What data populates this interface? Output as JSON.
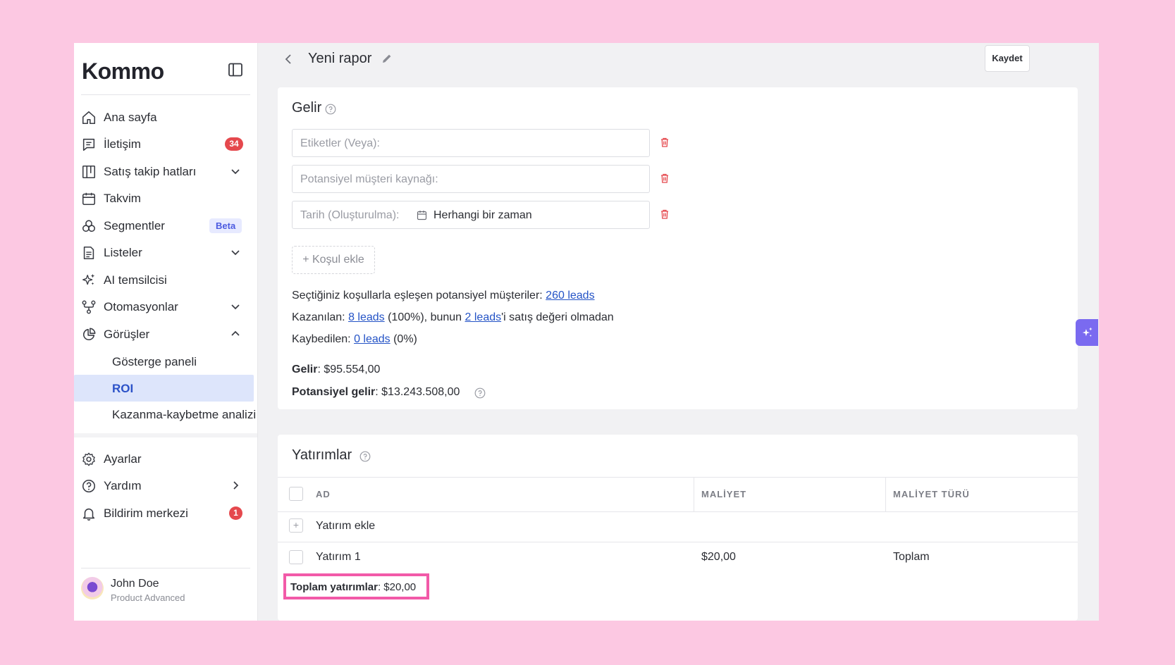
{
  "brand": {
    "logo_text": "Kommo"
  },
  "sidebar": {
    "items": [
      {
        "label": "Ana sayfa"
      },
      {
        "label": "İletişim",
        "badge": "34"
      },
      {
        "label": "Satış takip hatları"
      },
      {
        "label": "Takvim"
      },
      {
        "label": "Segmentler",
        "badge": "Beta"
      },
      {
        "label": "Listeler"
      },
      {
        "label": "AI temsilcisi"
      },
      {
        "label": "Otomasyonlar"
      },
      {
        "label": "Görüşler"
      }
    ],
    "sub_items": [
      {
        "label": "Gösterge paneli"
      },
      {
        "label": "ROI",
        "active": true
      },
      {
        "label": "Kazanma-kaybetme analizi"
      }
    ],
    "bottom_items": [
      {
        "label": "Ayarlar"
      },
      {
        "label": "Yardım"
      },
      {
        "label": "Bildirim merkezi",
        "badge": "1"
      }
    ],
    "user": {
      "name": "John Doe",
      "role": "Product Advanced"
    }
  },
  "header": {
    "title": "Yeni rapor",
    "save_label": "Kaydet"
  },
  "income": {
    "title": "Gelir",
    "filters": [
      {
        "placeholder": "Etiketler (Veya):"
      },
      {
        "placeholder": "Potansiyel müşteri kaynağı:"
      },
      {
        "placeholder": "Tarih (Oluşturulma):",
        "value": "Herhangi bir zaman"
      }
    ],
    "add_condition": "+ Koşul ekle",
    "matched_text": "Seçtiğiniz koşullarla eşleşen potansiyel müşteriler: ",
    "matched_link": "260 leads",
    "won_text": "Kazanılan: ",
    "won_link": "8 leads",
    "won_pct": " (100%), bunun ",
    "won_link2": "2 leads",
    "won_suffix": "'i satış değeri olmadan",
    "lost_text": "Kaybedilen: ",
    "lost_link": "0 leads",
    "lost_pct": " (0%)",
    "revenue_label": "Gelir",
    "revenue_value": ": $95.554,00",
    "potential_label": "Potansiyel gelir",
    "potential_value": ": $13.243.508,00"
  },
  "investments": {
    "title": "Yatırımlar",
    "columns": [
      "AD",
      "MALİYET",
      "MALİYET TÜRÜ"
    ],
    "add_label": "Yatırım ekle",
    "rows": [
      {
        "name": "Yatırım 1",
        "cost": "$20,00",
        "type": "Toplam"
      }
    ],
    "total_label": "Toplam yatırımlar",
    "total_value": ": $20,00"
  },
  "colors": {
    "accent": "#2453c6",
    "badge": "#e5484d",
    "highlight": "#f25aa8",
    "ai_button": "#7a6af0"
  }
}
